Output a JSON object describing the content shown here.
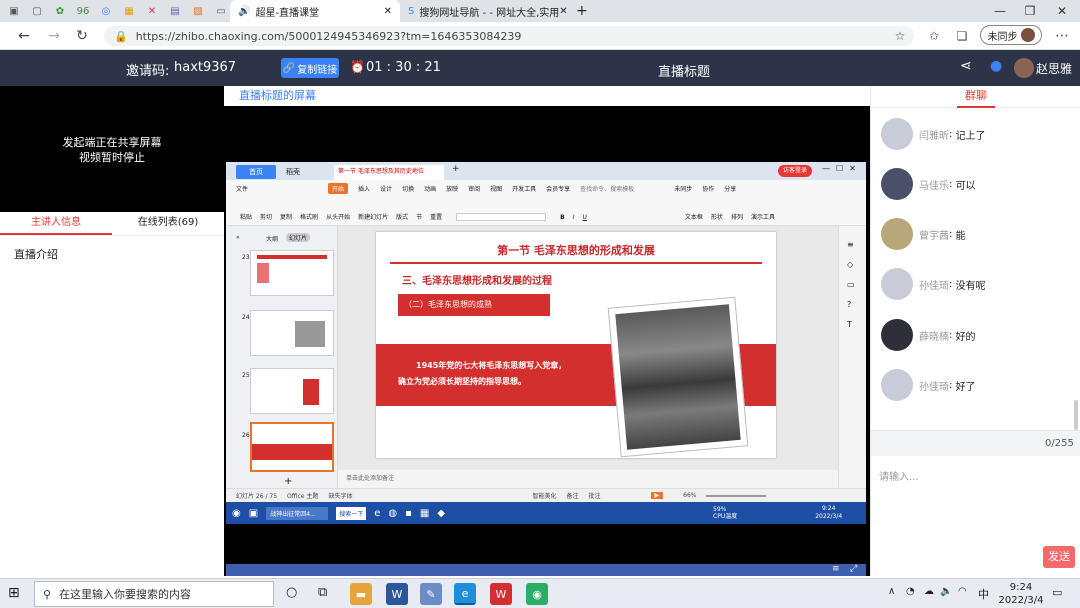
{
  "browser": {
    "tabs": [
      {
        "title": "超星-直播课堂"
      },
      {
        "title": "搜狗网址导航 - - 网址大全,实用"
      }
    ],
    "new_tab": "+",
    "url": "https://zhibo.chaoxing.com/5000124945346923?tm=1646353084239",
    "sync_label": "未同步"
  },
  "header": {
    "invite_label": "邀请码:",
    "invite_code": "haxt9367",
    "copy_label": "复制链接",
    "timer": "01 : 30 : 21",
    "title": "直播标题",
    "user": "赵思雅"
  },
  "left": {
    "video_line1": "发起端正在共享屏幕",
    "video_line2": "视频暂时停止",
    "tabs": [
      "主讲人信息",
      "在线列表(69)"
    ],
    "intro_label": "直播介绍"
  },
  "center": {
    "screen_title": "直播标题的屏幕",
    "ppt": {
      "top_tabs": [
        "首页",
        "稻壳",
        "第一节 毛泽东思想及其历史地位",
        "+"
      ],
      "login": "访客登录",
      "menu": [
        "文件",
        "开始",
        "插入",
        "设计",
        "切换",
        "动画",
        "放映",
        "审阅",
        "视图",
        "开发工具",
        "会员专享"
      ],
      "search": "查找命令、搜索模板",
      "right_menu": [
        "未同步",
        "协作",
        "分享"
      ],
      "tools": [
        "粘贴",
        "剪切",
        "复制",
        "格式刷",
        "从头开始",
        "新建幻灯片",
        "版式",
        "节",
        "重置",
        "文本框",
        "形状",
        "排列",
        "演示工具"
      ],
      "panel_tabs": [
        "大纲",
        "幻灯片"
      ],
      "slide_numbers": [
        "23",
        "24",
        "25",
        "26"
      ],
      "slide": {
        "title": "第一节 毛泽东思想的形成和发展",
        "subtitle": "三、毛泽东思想形成和发展的过程",
        "section": "（二）毛泽东思想的成熟",
        "body_line1": "1945年党的七大将毛泽东思想写入党章，",
        "body_line2": "确立为党必须长期坚持的指导思想。"
      },
      "note": "单击此处添加备注",
      "status_left": "幻灯片 26 / 75",
      "status_theme": "Office 主题",
      "status_font": "缺失字体",
      "status_right": [
        "智能美化",
        "备注",
        "批注"
      ],
      "zoom": "66%",
      "inner_taskbar": [
        "战神出征常回4...",
        "搜索一下"
      ],
      "inner_cpu": "59%\nCPU温度",
      "inner_time": "9:24",
      "inner_date": "2022/3/4"
    }
  },
  "right": {
    "tab": "群聊",
    "messages": [
      {
        "name": "闫雅昕",
        "text": "记上了"
      },
      {
        "name": "马佳乐",
        "text": "可以"
      },
      {
        "name": "曾宇茜",
        "text": "能"
      },
      {
        "name": "孙佳琦",
        "text": "没有呢"
      },
      {
        "name": "薛晓楠",
        "text": "好的"
      },
      {
        "name": "孙佳琦",
        "text": "好了"
      }
    ],
    "counter": "0/255",
    "input_placeholder": "请输入...",
    "send": "发送"
  },
  "taskbar": {
    "search": "在这里输入你要搜索的内容",
    "time": "9:24",
    "date": "2022/3/4",
    "ime": "中"
  }
}
